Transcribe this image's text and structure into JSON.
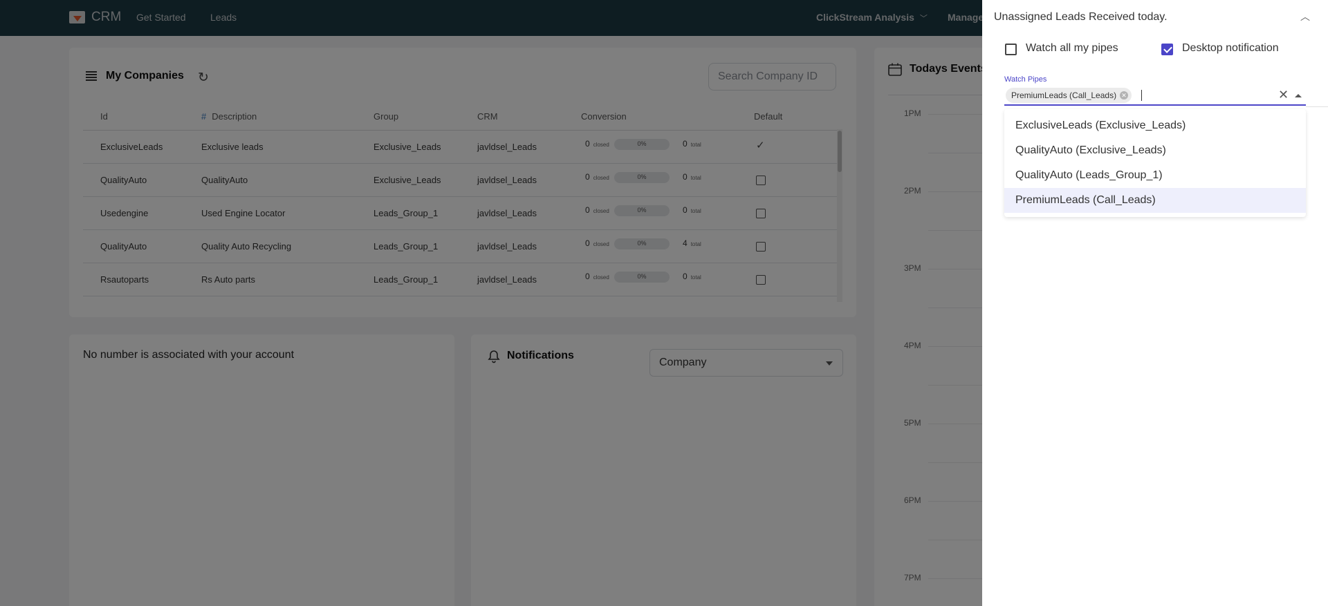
{
  "nav": {
    "brand": "CRM",
    "links": [
      "Get Started",
      "Leads"
    ],
    "right_menu": "ClickStream Analysis",
    "right_menu_2": "Manage"
  },
  "companies": {
    "title": "My Companies",
    "search_placeholder": "Search Company ID",
    "columns": [
      "Id",
      "Description",
      "Group",
      "CRM",
      "Conversion",
      "Default"
    ],
    "rows": [
      {
        "id": "ExclusiveLeads",
        "description": "Exclusive leads",
        "group": "Exclusive_Leads",
        "crm": "javldsel_Leads",
        "closed": "0",
        "closed_label": "closed",
        "percent": "0%",
        "percent_value": 0,
        "total": "0",
        "total_label": "total",
        "default": true
      },
      {
        "id": "QualityAuto",
        "description": "QualityAuto",
        "group": "Exclusive_Leads",
        "crm": "javldsel_Leads",
        "closed": "0",
        "closed_label": "closed",
        "percent": "0%",
        "percent_value": 0,
        "total": "0",
        "total_label": "total",
        "default": false
      },
      {
        "id": "Usedengine",
        "description": "Used Engine Locator",
        "group": "Leads_Group_1",
        "crm": "javldsel_Leads",
        "closed": "0",
        "closed_label": "closed",
        "percent": "0%",
        "percent_value": 0,
        "total": "0",
        "total_label": "total",
        "default": false
      },
      {
        "id": "QualityAuto",
        "description": "Quality Auto Recycling",
        "group": "Leads_Group_1",
        "crm": "javldsel_Leads",
        "closed": "0",
        "closed_label": "closed",
        "percent": "0%",
        "percent_value": 0,
        "total": "4",
        "total_label": "total",
        "default": false
      },
      {
        "id": "Rsautoparts",
        "description": "Rs Auto parts",
        "group": "Leads_Group_1",
        "crm": "javldsel_Leads",
        "closed": "0",
        "closed_label": "closed",
        "percent": "0%",
        "percent_value": 0,
        "total": "0",
        "total_label": "total",
        "default": false
      }
    ]
  },
  "phone": {
    "message": "No number is associated with your account"
  },
  "notifications": {
    "title": "Notifications",
    "filter_value": "Company"
  },
  "events": {
    "title": "Todays Events",
    "hours": [
      "1PM",
      "2PM",
      "3PM",
      "4PM",
      "5PM",
      "6PM",
      "7PM"
    ]
  },
  "drawer": {
    "title": "Unassigned Leads Received today.",
    "watch_all_label": "Watch all my pipes",
    "watch_all_checked": false,
    "desktop_notif_label": "Desktop notification",
    "desktop_notif_checked": true,
    "field_label": "Watch Pipes",
    "selected_chip": "PremiumLeads (Call_Leads)",
    "options": [
      "ExclusiveLeads (Exclusive_Leads)",
      "QualityAuto (Exclusive_Leads)",
      "QualityAuto (Leads_Group_1)",
      "PremiumLeads (Call_Leads)"
    ],
    "highlighted_option": 3,
    "accent_color": "#4b45c8"
  }
}
